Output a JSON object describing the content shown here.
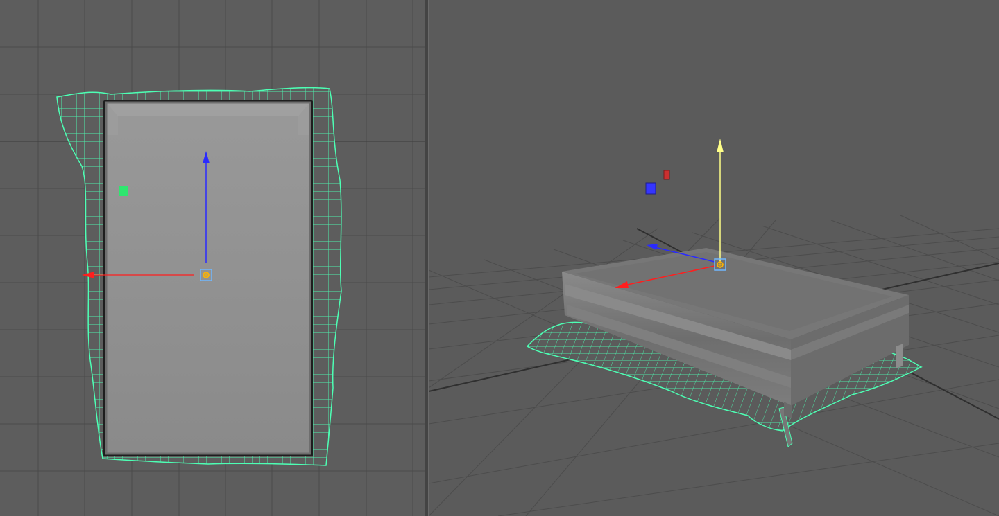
{
  "viewports": {
    "left": {
      "view": "top",
      "mode": "orthographic"
    },
    "right": {
      "view": "persp",
      "mode": "perspective"
    }
  },
  "colors": {
    "background": "#5d5d5d",
    "grid_line": "#4a4a4a",
    "grid_axis": "#2f2f2f",
    "mesh_fill": "#8e8e8e",
    "cloth_wire": "#4dffb4",
    "axis_x": "#ff1e1e",
    "axis_y": "#ffff88",
    "axis_z": "#2a2aff",
    "pivot_outline": "#6fb8ff",
    "pivot_center": "#ffb400"
  },
  "icons": {
    "pivot": "pivot-crosshair-icon",
    "scale_handle": "square-handle-icon"
  }
}
